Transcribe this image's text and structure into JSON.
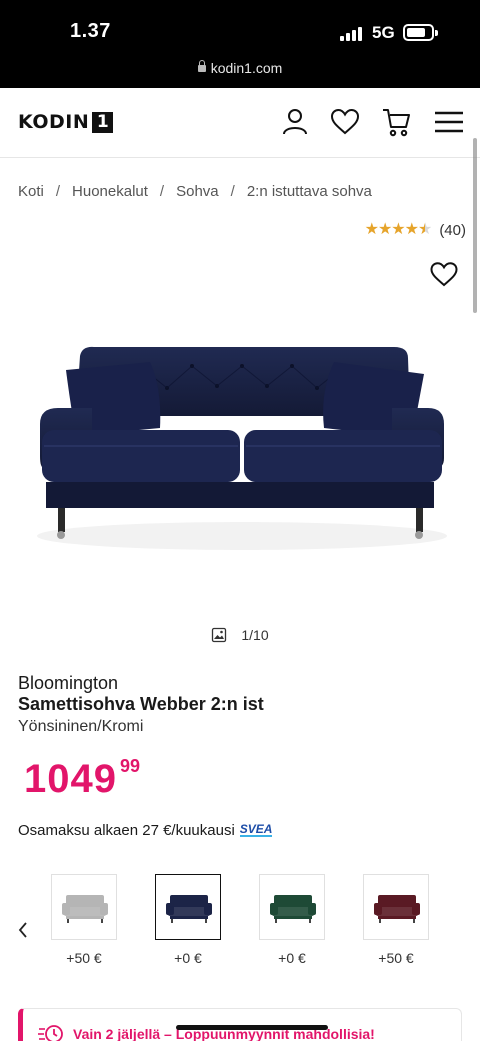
{
  "status_bar": {
    "time": "1.37",
    "network": "5G",
    "url": "kodin1.com"
  },
  "header": {
    "logo_text": "KODIN",
    "logo_box": "1",
    "icons": [
      "account-icon",
      "heart-icon",
      "cart-icon",
      "menu-icon"
    ]
  },
  "breadcrumb": {
    "items": [
      "Koti",
      "Huonekalut",
      "Sohva",
      "2:n istuttava sohva"
    ],
    "separator": "/"
  },
  "rating": {
    "stars": 4.5,
    "count": "(40)",
    "star_color": "#e6a42b"
  },
  "gallery": {
    "counter": "1/10"
  },
  "product": {
    "brand": "Bloomington",
    "name": "Samettisohva Webber 2:n ist",
    "variant": "Yönsininen/Kromi",
    "price_main": "1049",
    "price_cents": "99",
    "price_color": "#e2156a",
    "installment": "Osamaksu alkaen 27 €/kuukausi",
    "installment_provider": "SVEA"
  },
  "variants": [
    {
      "color_name": "light-grey",
      "color": "#b5b5b5",
      "price_diff": "+50 €",
      "selected": false
    },
    {
      "color_name": "navy",
      "color": "#1c2447",
      "price_diff": "+0 €",
      "selected": true
    },
    {
      "color_name": "green",
      "color": "#1e4a36",
      "price_diff": "+0 €",
      "selected": false
    },
    {
      "color_name": "burgundy",
      "color": "#5a1a24",
      "price_diff": "+50 €",
      "selected": false
    }
  ],
  "stock_banner": {
    "text": "Vain 2 jäljellä – Loppuunmyynnit mahdollisia!"
  }
}
